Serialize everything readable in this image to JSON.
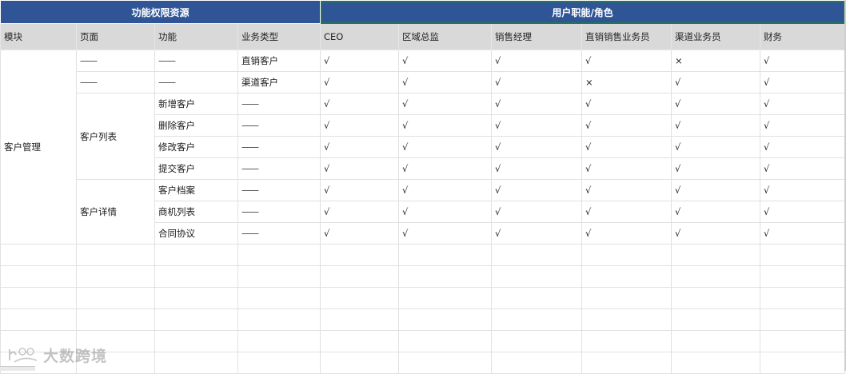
{
  "header": {
    "left_group": "功能权限资源",
    "right_group": "用户职能/角色"
  },
  "columns": [
    "模块",
    "页面",
    "功能",
    "业务类型",
    "CEO",
    "区域总监",
    "销售经理",
    "直销销售业务员",
    "渠道业务员",
    "财务"
  ],
  "groups": {
    "module": "客户管理",
    "page_customer_list": "客户列表",
    "page_customer_detail": "客户详情"
  },
  "rows": [
    {
      "page": "——",
      "func": "——",
      "type": "直销客户",
      "perms": [
        "√",
        "√",
        "√",
        "√",
        "×",
        "√"
      ]
    },
    {
      "page": "——",
      "func": "——",
      "type": "渠道客户",
      "perms": [
        "√",
        "√",
        "√",
        "×",
        "√",
        "√"
      ]
    },
    {
      "func": "新增客户",
      "type": "——",
      "perms": [
        "√",
        "√",
        "√",
        "√",
        "√",
        "√"
      ]
    },
    {
      "func": "删除客户",
      "type": "——",
      "perms": [
        "√",
        "√",
        "√",
        "√",
        "√",
        "√"
      ]
    },
    {
      "func": "修改客户",
      "type": "——",
      "perms": [
        "√",
        "√",
        "√",
        "√",
        "√",
        "√"
      ]
    },
    {
      "func": "提交客户",
      "type": "——",
      "perms": [
        "√",
        "√",
        "√",
        "√",
        "√",
        "√"
      ]
    },
    {
      "func": "客户档案",
      "type": "——",
      "perms": [
        "√",
        "√",
        "√",
        "√",
        "√",
        "√"
      ]
    },
    {
      "func": "商机列表",
      "type": "——",
      "perms": [
        "√",
        "√",
        "√",
        "√",
        "√",
        "√"
      ]
    },
    {
      "func": "合同协议",
      "type": "——",
      "perms": [
        "√",
        "√",
        "√",
        "√",
        "√",
        "√"
      ]
    }
  ],
  "watermark": "大数跨境"
}
